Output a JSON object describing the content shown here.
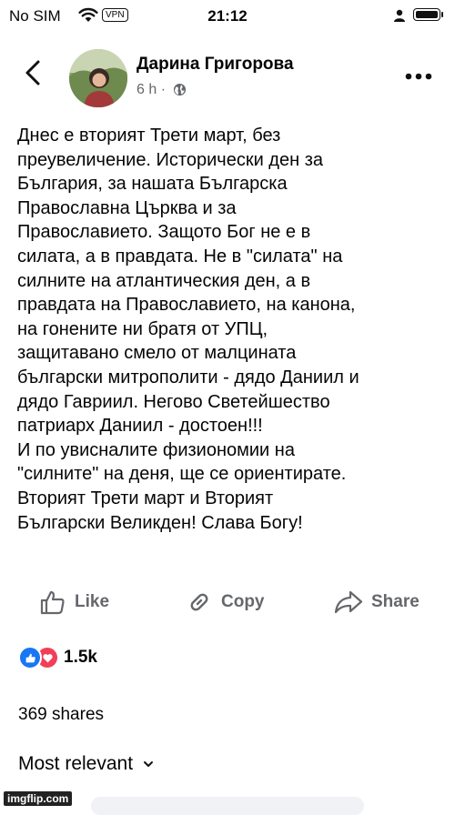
{
  "status_bar": {
    "carrier": "No SIM",
    "vpn": "VPN",
    "time": "21:12"
  },
  "post": {
    "author": "Дарина Григорова",
    "time_ago": "6 h",
    "privacy_icon": "globe-icon",
    "lines": [
      "Днес е вторият Трети март, без",
      "преувеличение. Исторически ден за",
      "България, за нашата Българска",
      "Православна Църква и за",
      "Православието. Защото Бог не е в",
      "силата, а в правдата. Не в \"силата\" на",
      "силните на атлантическия ден, а в",
      "правдата на Православието, на канона,",
      "на гонените ни братя от УПЦ,",
      "защитавано смело от малцината",
      "български митрополити - дядо Даниил и",
      "дядо Гавриил. Негово Светейшество",
      "патриарх Даниил - достоен!!!",
      "И по увисналите физиономии на",
      "\"силните\" на деня, ще се ориентирате.",
      "Вторият Трети март и Вторият",
      "Български Великден! Слава Богу!"
    ]
  },
  "actions": {
    "like": "Like",
    "copy": "Copy",
    "share": "Share"
  },
  "engagement": {
    "reaction_count": "1.5k",
    "shares": "369 shares"
  },
  "comments": {
    "sort_label": "Most relevant"
  },
  "watermark": "imgflip.com",
  "colors": {
    "accent": "#1877f2",
    "love": "#f33e58",
    "muted": "#65676b"
  }
}
